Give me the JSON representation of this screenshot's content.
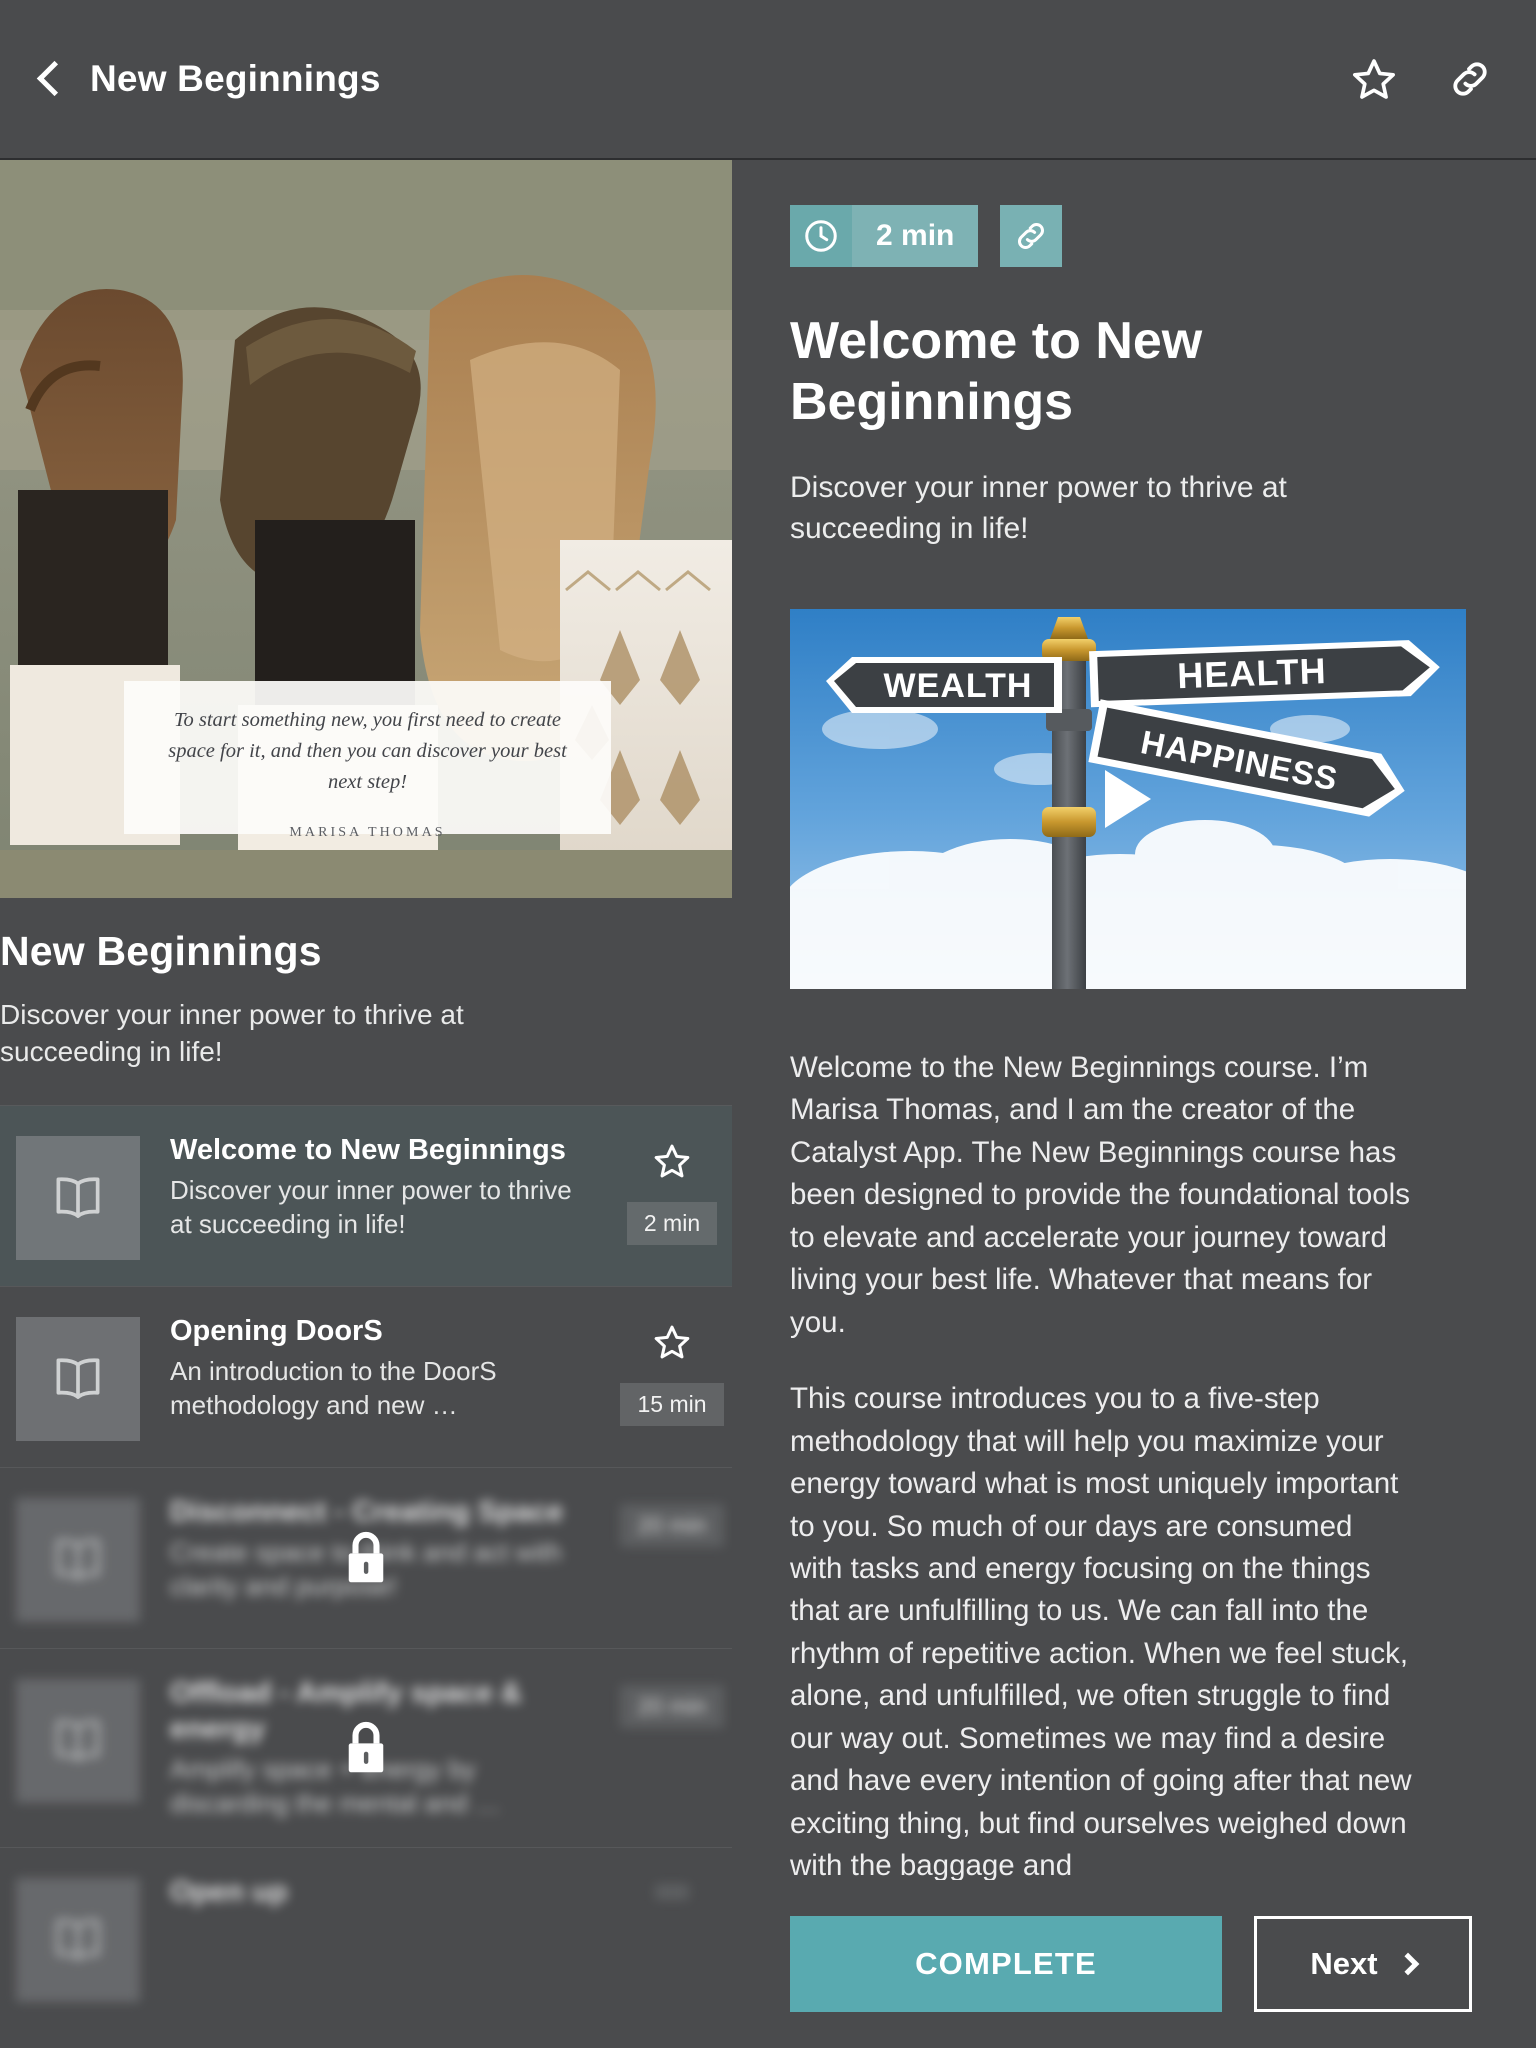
{
  "header": {
    "title": "New Beginnings",
    "back_icon": "chevron-left-icon",
    "favorite_icon": "star-outline-icon",
    "share_icon": "link-icon"
  },
  "course": {
    "title": "New Beginnings",
    "subtitle": "Discover your inner power to thrive at succeeding in life!",
    "hero_quote": {
      "text": "To start something new, you first need to create space for it, and then you can discover your best next step!",
      "author": "MARISA THOMAS"
    },
    "lessons": [
      {
        "name": "Welcome to New Beginnings",
        "desc": "Discover your inner power to thrive at succeeding in life!",
        "duration": "2 min",
        "locked": false,
        "active": true,
        "icon": "book-icon",
        "star_icon": "star-outline-icon"
      },
      {
        "name": "Opening DoorS",
        "desc": "An introduction to the DoorS methodology and new …",
        "duration": "15 min",
        "locked": false,
        "active": false,
        "icon": "book-icon",
        "star_icon": "star-outline-icon"
      },
      {
        "name": "Disconnect - Creating Space",
        "desc": "Create space to think and act with clarity and purpose!",
        "duration": "20 min",
        "locked": true,
        "active": false,
        "icon": "book-icon",
        "lock_icon": "lock-icon"
      },
      {
        "name": "Offload - Amplify space & energy",
        "desc": "Amplify space + energy by discarding the mental and …",
        "duration": "20 min",
        "locked": true,
        "active": false,
        "icon": "book-icon",
        "lock_icon": "lock-icon"
      },
      {
        "name": "Open up",
        "desc": "",
        "duration": "",
        "locked": true,
        "active": false,
        "icon": "book-icon",
        "lock_icon": "lock-icon"
      }
    ]
  },
  "lesson": {
    "duration": "2 min",
    "clock_icon": "clock-icon",
    "link_icon": "link-icon",
    "title": "Welcome to New Beginnings",
    "lede": "Discover your inner power to thrive at succeeding in life!",
    "video": {
      "play_icon": "play-icon",
      "sign_wealth": "WEALTH",
      "sign_health": "HEALTH",
      "sign_happiness": "HAPPINESS"
    },
    "paragraphs": [
      "Welcome to the New Beginnings course. I’m Marisa Thomas, and I am the creator of the Catalyst App. The New Beginnings course has been designed to provide the foundational tools to elevate and accelerate your journey toward living your best life. Whatever that means for you.",
      "This course introduces you to a five-step methodology that will help you maximize your energy toward what is most uniquely important to you. So much of our days are consumed with tasks and energy focusing on the things that are unfulfilling to us. We can fall into the rhythm of repetitive action. When we feel stuck, alone, and unfulfilled, we often struggle to find our way out. Sometimes we may find a desire and have every intention of going after that new exciting thing, but find ourselves weighed down with the baggage and"
    ]
  },
  "footer": {
    "complete_label": "COMPLETE",
    "next_label": "Next",
    "next_icon": "chevron-right-icon"
  },
  "colors": {
    "page_bg": "#4a4b4d",
    "accent_teal": "#59aab0",
    "badge_teal_light": "#7eb2b4",
    "badge_teal_dark": "#6aa9ab",
    "active_row": "#4c5557"
  }
}
